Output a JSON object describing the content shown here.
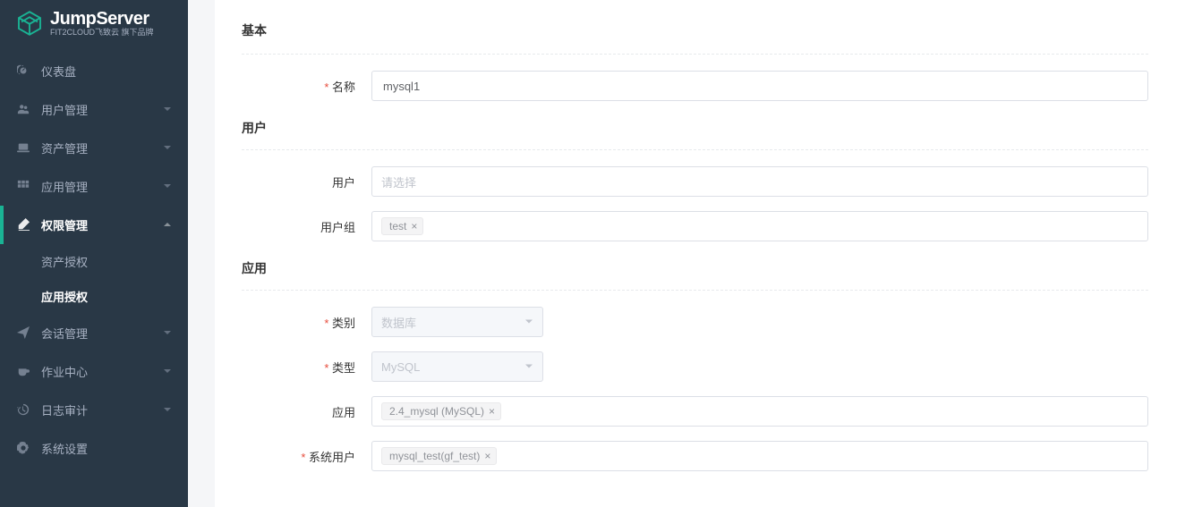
{
  "brand": {
    "name": "JumpServer",
    "sub": "FIT2CLOUD飞致云 旗下品牌"
  },
  "sidebar": {
    "items": [
      {
        "label": "仪表盘",
        "icon": "dashboard",
        "children": false
      },
      {
        "label": "用户管理",
        "icon": "users",
        "children": true
      },
      {
        "label": "资产管理",
        "icon": "laptop",
        "children": true
      },
      {
        "label": "应用管理",
        "icon": "grid",
        "children": true
      },
      {
        "label": "权限管理",
        "icon": "edit",
        "children": true,
        "active": true,
        "sub": [
          {
            "label": "资产授权"
          },
          {
            "label": "应用授权",
            "active": true
          }
        ]
      },
      {
        "label": "会话管理",
        "icon": "send",
        "children": true
      },
      {
        "label": "作业中心",
        "icon": "coffee",
        "children": true
      },
      {
        "label": "日志审计",
        "icon": "history",
        "children": true
      },
      {
        "label": "系统设置",
        "icon": "gear",
        "children": false
      }
    ]
  },
  "form": {
    "sections": {
      "basic": "基本",
      "user": "用户",
      "app": "应用"
    },
    "labels": {
      "name": "名称",
      "user": "用户",
      "usergroup": "用户组",
      "category": "类别",
      "type": "类型",
      "application": "应用",
      "sysuser": "系统用户"
    },
    "values": {
      "name": "mysql1",
      "user_placeholder": "请选择",
      "usergroup_tag": "test",
      "category": "数据库",
      "type": "MySQL",
      "application_tag": "2.4_mysql (MySQL)",
      "sysuser_tag": "mysql_test(gf_test)"
    }
  }
}
